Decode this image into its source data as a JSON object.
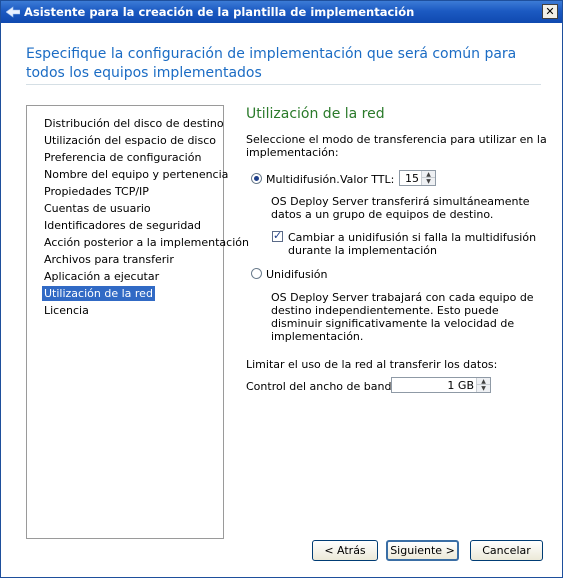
{
  "window": {
    "title": "Asistente para la creación de la plantilla de implementación",
    "close_glyph": "✕"
  },
  "header": {
    "text": "Especifique la configuración de implementación que será común para todos los equipos implementados"
  },
  "nav": {
    "items": [
      {
        "label": "Distribución del disco de destino"
      },
      {
        "label": "Utilización del espacio de disco"
      },
      {
        "label": "Preferencia de configuración"
      },
      {
        "label": "Nombre del equipo y pertenencia"
      },
      {
        "label": "Propiedades TCP/IP"
      },
      {
        "label": "Cuentas de usuario"
      },
      {
        "label": "Identificadores de seguridad"
      },
      {
        "label": "Acción posterior a la implementación"
      },
      {
        "label": "Archivos para transferir"
      },
      {
        "label": "Aplicación a ejecutar"
      },
      {
        "label": "Utilización de la red",
        "selected": true
      },
      {
        "label": "Licencia"
      }
    ]
  },
  "section": {
    "title": "Utilización de la red",
    "intro_line1": "Seleccione el modo de transferencia para utilizar en la",
    "intro_line2": "implementación:",
    "multicast": {
      "label": "Multidifusión.",
      "ttl_label": "Valor TTL:",
      "ttl_value": "15",
      "desc_line1": "OS Deploy Server transferirá simultáneamente",
      "desc_line2": "datos a un grupo de equipos de destino.",
      "fallback_line1": "Cambiar a unidifusión si falla la multidifusión",
      "fallback_line2": "durante la implementación",
      "fallback_checked": true,
      "selected": true
    },
    "unicast": {
      "label": "Unidifusión",
      "desc_line1": "OS Deploy Server trabajará con cada equipo de",
      "desc_line2": "destino independientemente. Esto puede",
      "desc_line3": "disminuir significativamente la velocidad de",
      "desc_line4": "implementación.",
      "selected": false
    },
    "limit_text": "Limitar el uso de la red al transferir los datos:",
    "bandwidth_label": "Control del ancho de banda:",
    "bandwidth_value": "1 GB"
  },
  "footer": {
    "back_label": "< Atrás",
    "next_label": "Siguiente >",
    "cancel_label": "Cancelar"
  }
}
